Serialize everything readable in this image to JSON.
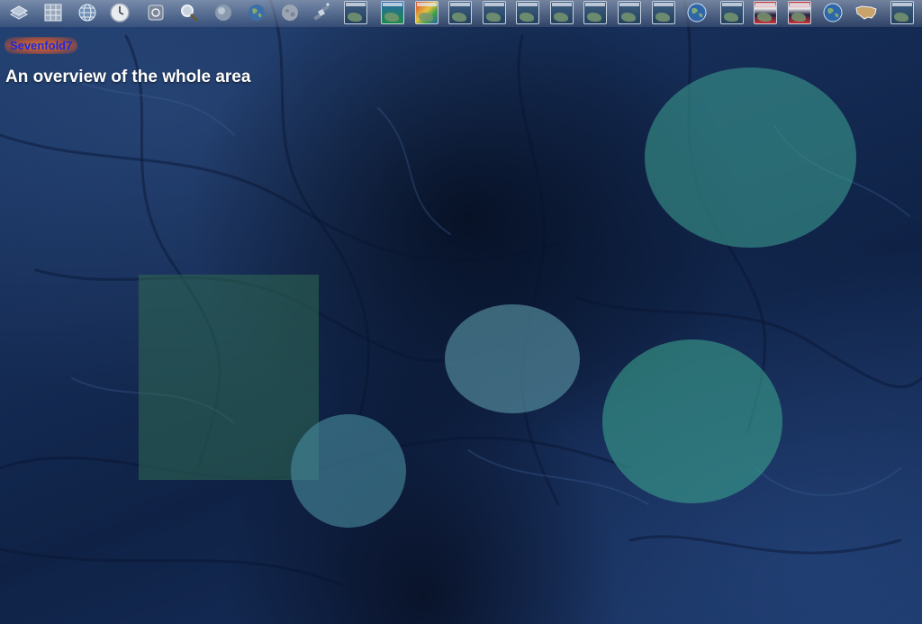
{
  "app": {
    "badge_text": "Sevenfold7"
  },
  "scene": {
    "title": "An overview of the whole area"
  },
  "toolbar": {
    "tools": [
      {
        "name": "layer-manager-icon"
      },
      {
        "name": "lat-lon-grid-icon"
      },
      {
        "name": "globe-grid-icon"
      },
      {
        "name": "clock-icon"
      },
      {
        "name": "compass-icon"
      },
      {
        "name": "search-magnifier-icon"
      },
      {
        "name": "globe-atmosphere-icon"
      },
      {
        "name": "earth-globe-icon"
      },
      {
        "name": "moon-globe-icon"
      },
      {
        "name": "satellite-icon"
      }
    ],
    "layers": [
      {
        "name": "layer-thumb-1-icon",
        "style": ""
      },
      {
        "name": "layer-wms-icon",
        "style": "wms"
      },
      {
        "name": "layer-heatmap-icon",
        "style": "heat"
      },
      {
        "name": "layer-thumb-4-icon",
        "style": ""
      },
      {
        "name": "layer-thumb-5-icon",
        "style": ""
      },
      {
        "name": "layer-thumb-6-icon",
        "style": ""
      },
      {
        "name": "layer-thumb-7-icon",
        "style": ""
      },
      {
        "name": "layer-thumb-8-icon",
        "style": ""
      },
      {
        "name": "layer-thumb-9-icon",
        "style": ""
      },
      {
        "name": "layer-thumb-10-icon",
        "style": ""
      },
      {
        "name": "blue-marble-globe-icon",
        "style": "globe"
      },
      {
        "name": "layer-map-icon",
        "style": ""
      },
      {
        "name": "layer-flags-icon",
        "style": "flags"
      },
      {
        "name": "layer-flags-2-icon",
        "style": "flags"
      },
      {
        "name": "landmarks-globe-icon",
        "style": "globe"
      },
      {
        "name": "usa-map-icon",
        "style": "usa"
      },
      {
        "name": "layer-thumb-last-icon",
        "style": ""
      }
    ]
  },
  "regions": [
    {
      "name": "region-square-west",
      "shape": "rect",
      "color": "#2f6a52"
    },
    {
      "name": "region-circle-southwest",
      "shape": "ellipse",
      "color": "#4a8ea0"
    },
    {
      "name": "region-ellipse-center",
      "shape": "ellipse",
      "color": "#5e9aa8"
    },
    {
      "name": "region-ellipse-northeast",
      "shape": "ellipse",
      "color": "#3a9a8e"
    },
    {
      "name": "region-ellipse-east",
      "shape": "ellipse",
      "color": "#3aa08c"
    }
  ]
}
